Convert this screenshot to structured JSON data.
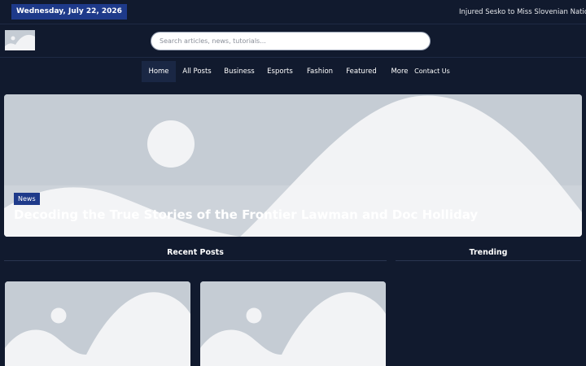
{
  "topbar": {
    "date": "Wednesday, July 22, 2026",
    "ticker": "Injured Sesko to Miss Slovenian National Te"
  },
  "header": {
    "logo_icon": "image-placeholder-icon",
    "search_placeholder": "Search articles, news, tutorials..."
  },
  "nav": {
    "items": [
      {
        "label": "Home",
        "active": true
      },
      {
        "label": "All Posts"
      },
      {
        "label": "Business"
      },
      {
        "label": "Esports"
      },
      {
        "label": "Fashion"
      },
      {
        "label": "Featured"
      },
      {
        "label": "More"
      },
      {
        "label": "Contact Us"
      }
    ]
  },
  "hero": {
    "tag": "News",
    "title": "Decoding the True Stories of the Frontier Lawman and Doc Holliday",
    "image_icon": "image-placeholder-icon"
  },
  "sections": {
    "recent": "Recent Posts",
    "trending": "Trending"
  },
  "colors": {
    "background": "#111a2e",
    "accent": "#1e3a8a",
    "placeholder": "#c5ccd4",
    "placeholder_shape": "#f2f3f5"
  }
}
